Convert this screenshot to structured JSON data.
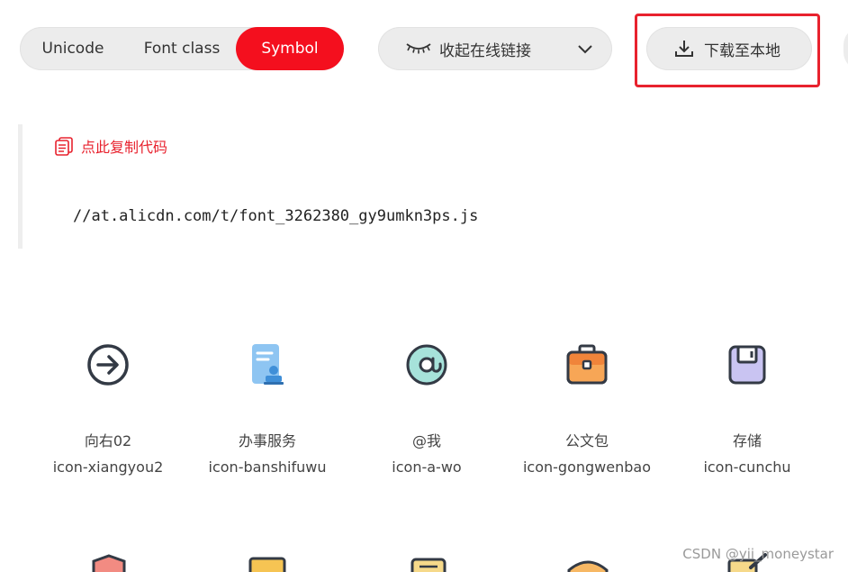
{
  "toolbar": {
    "tabs": [
      {
        "label": "Unicode",
        "selected": false
      },
      {
        "label": "Font class",
        "selected": false
      },
      {
        "label": "Symbol",
        "selected": true
      }
    ],
    "collapse_label": "收起在线链接",
    "download_label": "下载至本地"
  },
  "code": {
    "copy_label": "点此复制代码",
    "url": "//at.alicdn.com/t/font_3262380_gy9umkn3ps.js"
  },
  "icons": [
    {
      "name": "向右02",
      "code": "icon-xiangyou2",
      "glyph": "arrow-right-circle-icon"
    },
    {
      "name": "办事服务",
      "code": "icon-banshifuwu",
      "glyph": "document-seal-icon"
    },
    {
      "name": "@我",
      "code": "icon-a-wo",
      "glyph": "at-icon"
    },
    {
      "name": "公文包",
      "code": "icon-gongwenbao",
      "glyph": "briefcase-icon"
    },
    {
      "name": "存储",
      "code": "icon-cunchu",
      "glyph": "storage-icon"
    }
  ],
  "watermark": "CSDN @yii_moneystar",
  "colors": {
    "accent": "#f40f1e",
    "highlight_border": "#e8222e",
    "button_bg": "#ececec"
  }
}
